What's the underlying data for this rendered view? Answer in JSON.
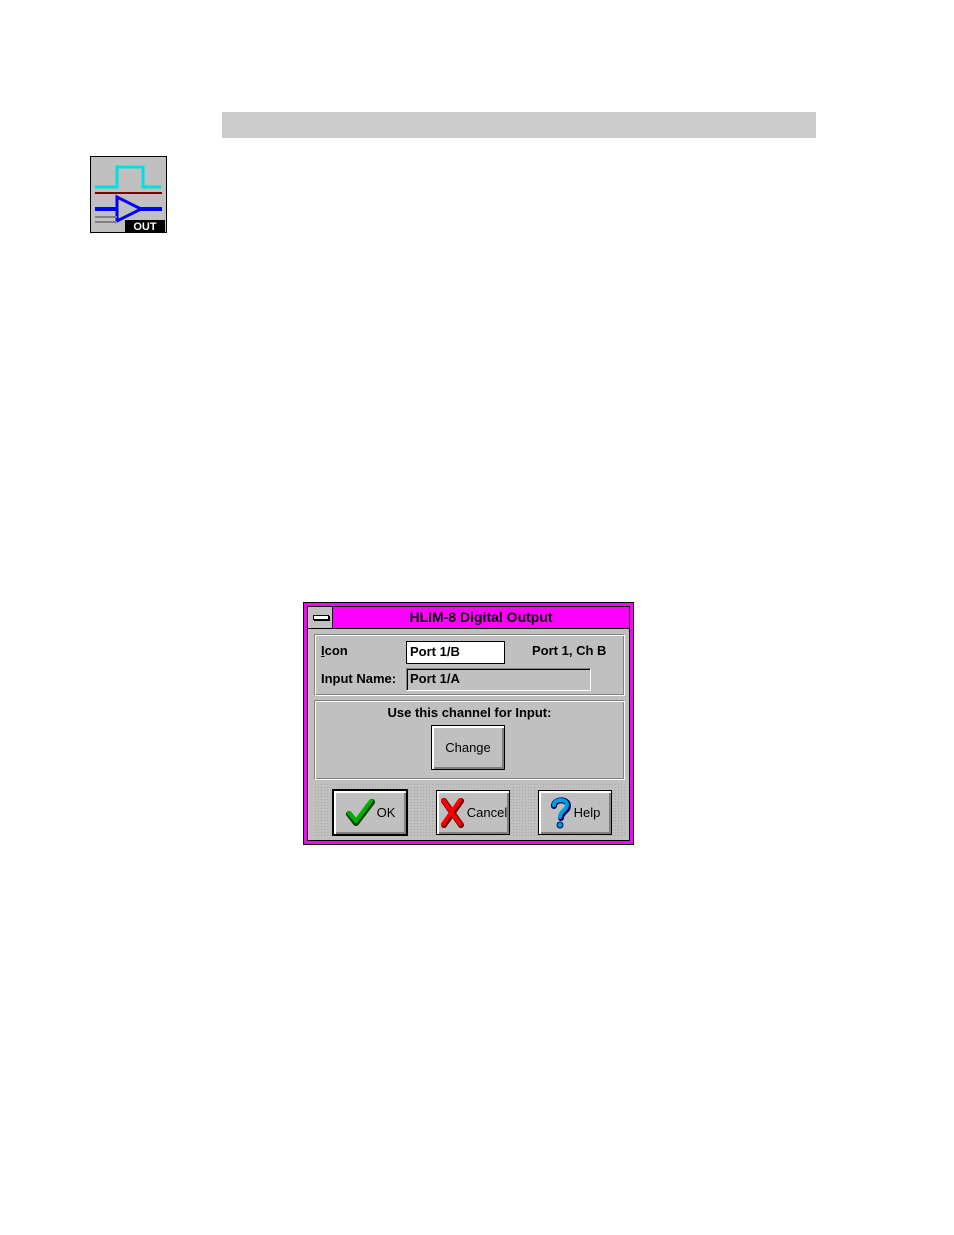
{
  "dialog": {
    "title": "HLIM-8 Digital Output",
    "icon_label_prefix": "I",
    "icon_label_rest": "con",
    "icon_value": "Port 1/B",
    "port_channel": "Port 1, Ch B",
    "input_name_label": "Input Name:",
    "input_name_value": "Port 1/A",
    "use_channel_label": "Use this channel for Input:",
    "change_label": "Change",
    "ok_label": "OK",
    "cancel_label": "Cancel",
    "help_label": "Help"
  },
  "icons": {
    "app": "digital-output-icon",
    "ok": "checkmark-icon",
    "cancel": "red-x-icon",
    "help": "question-mark-icon"
  },
  "colors": {
    "titlebar": "#ff00ff",
    "window_bg": "#c0c0c0",
    "header_bar": "#cccccc"
  }
}
